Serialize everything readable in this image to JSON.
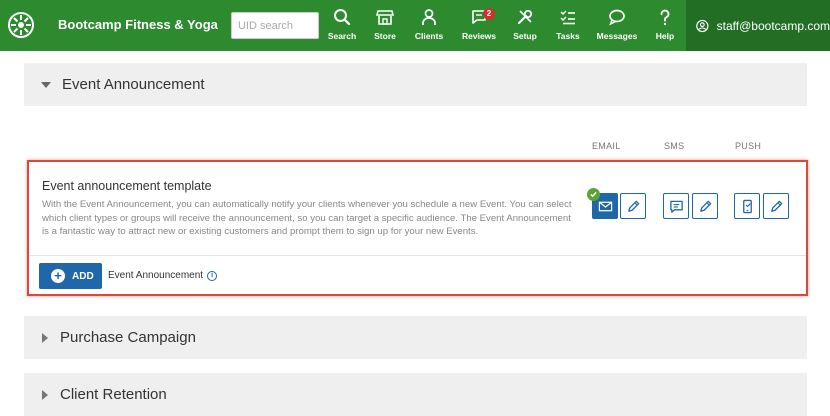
{
  "app": {
    "title": "Bootcamp Fitness & Yoga",
    "search_placeholder": "UID search"
  },
  "nav": [
    {
      "label": "Search",
      "icon": "search-icon"
    },
    {
      "label": "Store",
      "icon": "store-icon"
    },
    {
      "label": "Clients",
      "icon": "clients-icon"
    },
    {
      "label": "Reviews",
      "icon": "reviews-icon",
      "badge": "2"
    },
    {
      "label": "Setup",
      "icon": "setup-icon"
    },
    {
      "label": "Tasks",
      "icon": "tasks-icon"
    },
    {
      "label": "Messages",
      "icon": "messages-icon"
    },
    {
      "label": "Help",
      "icon": "help-icon"
    }
  ],
  "user": {
    "email": "staff@bootcamp.com"
  },
  "sections": {
    "event": {
      "title": "Event Announcement",
      "expanded": true
    },
    "purchase": {
      "title": "Purchase Campaign",
      "expanded": false
    },
    "retention": {
      "title": "Client Retention",
      "expanded": false
    }
  },
  "columns": {
    "email": "EMAIL",
    "sms": "SMS",
    "push": "PUSH"
  },
  "card": {
    "title": "Event announcement template",
    "description": "With the Event Announcement, you can automatically notify your clients whenever you schedule a new Event. You can select which client types or groups will receive the announcement, so you can target a specific audience. The Event Announcement is a fantastic way to attract new or existing customers and prompt them to sign up for your new Events.",
    "add_label": "ADD",
    "footer_label": "Event Announcement",
    "email_enabled": true
  },
  "colors": {
    "topbar": "#2d8a2f",
    "topbar_user": "#236e25",
    "primary": "#1f67a8",
    "highlight": "#d9493e",
    "check": "#5aa532",
    "badge": "#d32f2f"
  }
}
